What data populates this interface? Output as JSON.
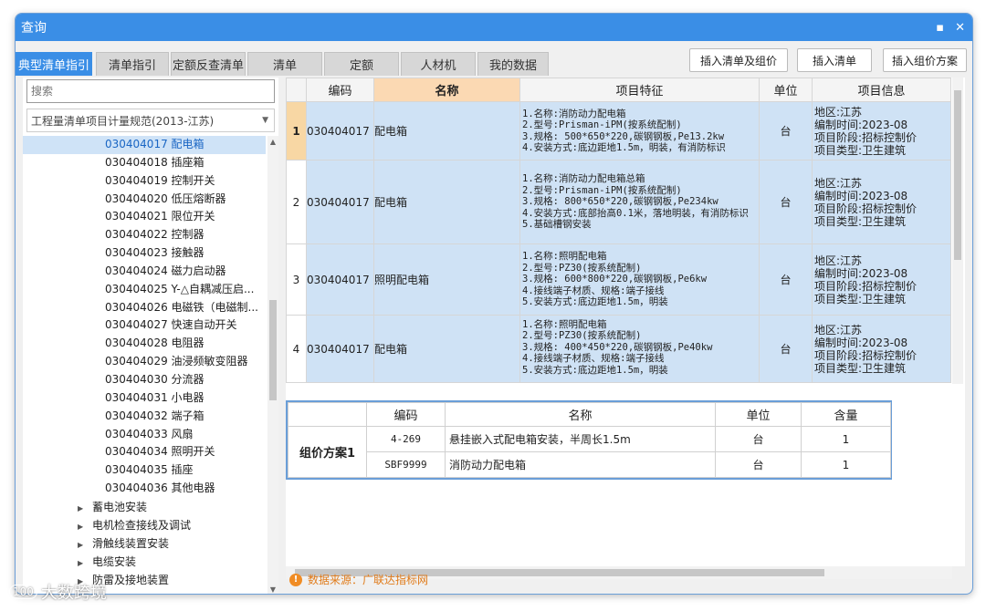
{
  "window": {
    "title": "查询",
    "controls": [
      "▪",
      "✕"
    ]
  },
  "tabs": [
    "典型清单指引",
    "清单指引",
    "定额反查清单",
    "清单",
    "定额",
    "人材机",
    "我的数据"
  ],
  "toolbar": {
    "insert_bill_and_price": "插入清单及组价",
    "insert_bill": "插入清单",
    "insert_price_scheme": "插入组价方案"
  },
  "left": {
    "search_placeholder": "搜索",
    "spec_select": "工程量清单项目计量规范(2013-江苏)",
    "tree_items": [
      "030404017 配电箱",
      "030404018 插座箱",
      "030404019 控制开关",
      "030404020 低压熔断器",
      "030404021 限位开关",
      "030404022 控制器",
      "030404023 接触器",
      "030404024 磁力启动器",
      "030404025 Y-△自耦减压启...",
      "030404026 电磁铁（电磁制...",
      "030404027 快速自动开关",
      "030404028 电阻器",
      "030404029 油浸频敏变阻器",
      "030404030 分流器",
      "030404031 小电器",
      "030404032 端子箱",
      "030404033 风扇",
      "030404034 照明开关",
      "030404035 插座",
      "030404036 其他电器"
    ],
    "tree_parents": [
      "蓄电池安装",
      "电机检查接线及调试",
      "滑触线装置安装",
      "电缆安装",
      "防雷及接地装置"
    ]
  },
  "grid": {
    "headers": [
      "",
      "编码",
      "名称",
      "项目特征",
      "单位",
      "项目信息"
    ],
    "rows": [
      {
        "index": "1",
        "code": "030404017",
        "name": "配电箱",
        "features": [
          "1.名称:消防动力配电箱",
          "2.型号:Prisman-iPM(按系统配制)",
          "3.规格: 500*650*220,碳钢钢板,Pe13.2kw",
          "4.安装方式:底边距地1.5m，明装，有消防标识"
        ],
        "unit": "台",
        "info": [
          "地区:江苏",
          "编制时间:2023-08",
          "项目阶段:招标控制价",
          "项目类型:卫生建筑"
        ]
      },
      {
        "index": "2",
        "code": "030404017",
        "name": "配电箱",
        "features": [
          "1.名称:消防动力配电箱总箱",
          "2.型号:Prisman-iPM(按系统配制)",
          "3.规格: 800*650*220,碳钢钢板,Pe234kw",
          "4.安装方式:底部抬高0.1米，落地明装，有消防标识",
          "5.基础槽钢安装"
        ],
        "unit": "台",
        "info": [
          "地区:江苏",
          "编制时间:2023-08",
          "项目阶段:招标控制价",
          "项目类型:卫生建筑"
        ]
      },
      {
        "index": "3",
        "code": "030404017",
        "name": "照明配电箱",
        "features": [
          "1.名称:照明配电箱",
          "2.型号:PZ30(按系统配制)",
          "3.规格: 600*800*220,碳钢钢板,Pe6kw",
          "4.接线端子材质、规格:端子接线",
          "5.安装方式:底边距地1.5m，明装"
        ],
        "unit": "台",
        "info": [
          "地区:江苏",
          "编制时间:2023-08",
          "项目阶段:招标控制价",
          "项目类型:卫生建筑"
        ]
      },
      {
        "index": "4",
        "code": "030404017",
        "name": "配电箱",
        "features": [
          "1.名称:照明配电箱",
          "2.型号:PZ30(按系统配制)",
          "3.规格: 400*450*220,碳钢钢板,Pe40kw",
          "4.接线端子材质、规格:端子接线",
          "5.安装方式:底边距地1.5m，明装"
        ],
        "unit": "台",
        "info": [
          "地区:江苏",
          "编制时间:2023-08",
          "项目阶段:招标控制价",
          "项目类型:卫生建筑"
        ]
      }
    ]
  },
  "scheme": {
    "headers": [
      "",
      "编码",
      "名称",
      "单位",
      "含量"
    ],
    "label": "组价方案1",
    "rows": [
      {
        "code": "4-269",
        "name": "悬挂嵌入式配电箱安装，半周长1.5m",
        "unit": "台",
        "qty": "1"
      },
      {
        "code": "SBF9999",
        "name": "消防动力配电箱",
        "unit": "台",
        "qty": "1"
      }
    ]
  },
  "footer": {
    "source_icon": "!",
    "source": "数据来源：广联达指标网"
  },
  "watermark": {
    "mark": "100",
    "text": "大数跨境"
  },
  "colors": {
    "accent": "#3a8ee6",
    "selected_cell": "#cfe2f5",
    "header_highlight": "#fbd9b3",
    "source_orange": "#e07b1a"
  }
}
